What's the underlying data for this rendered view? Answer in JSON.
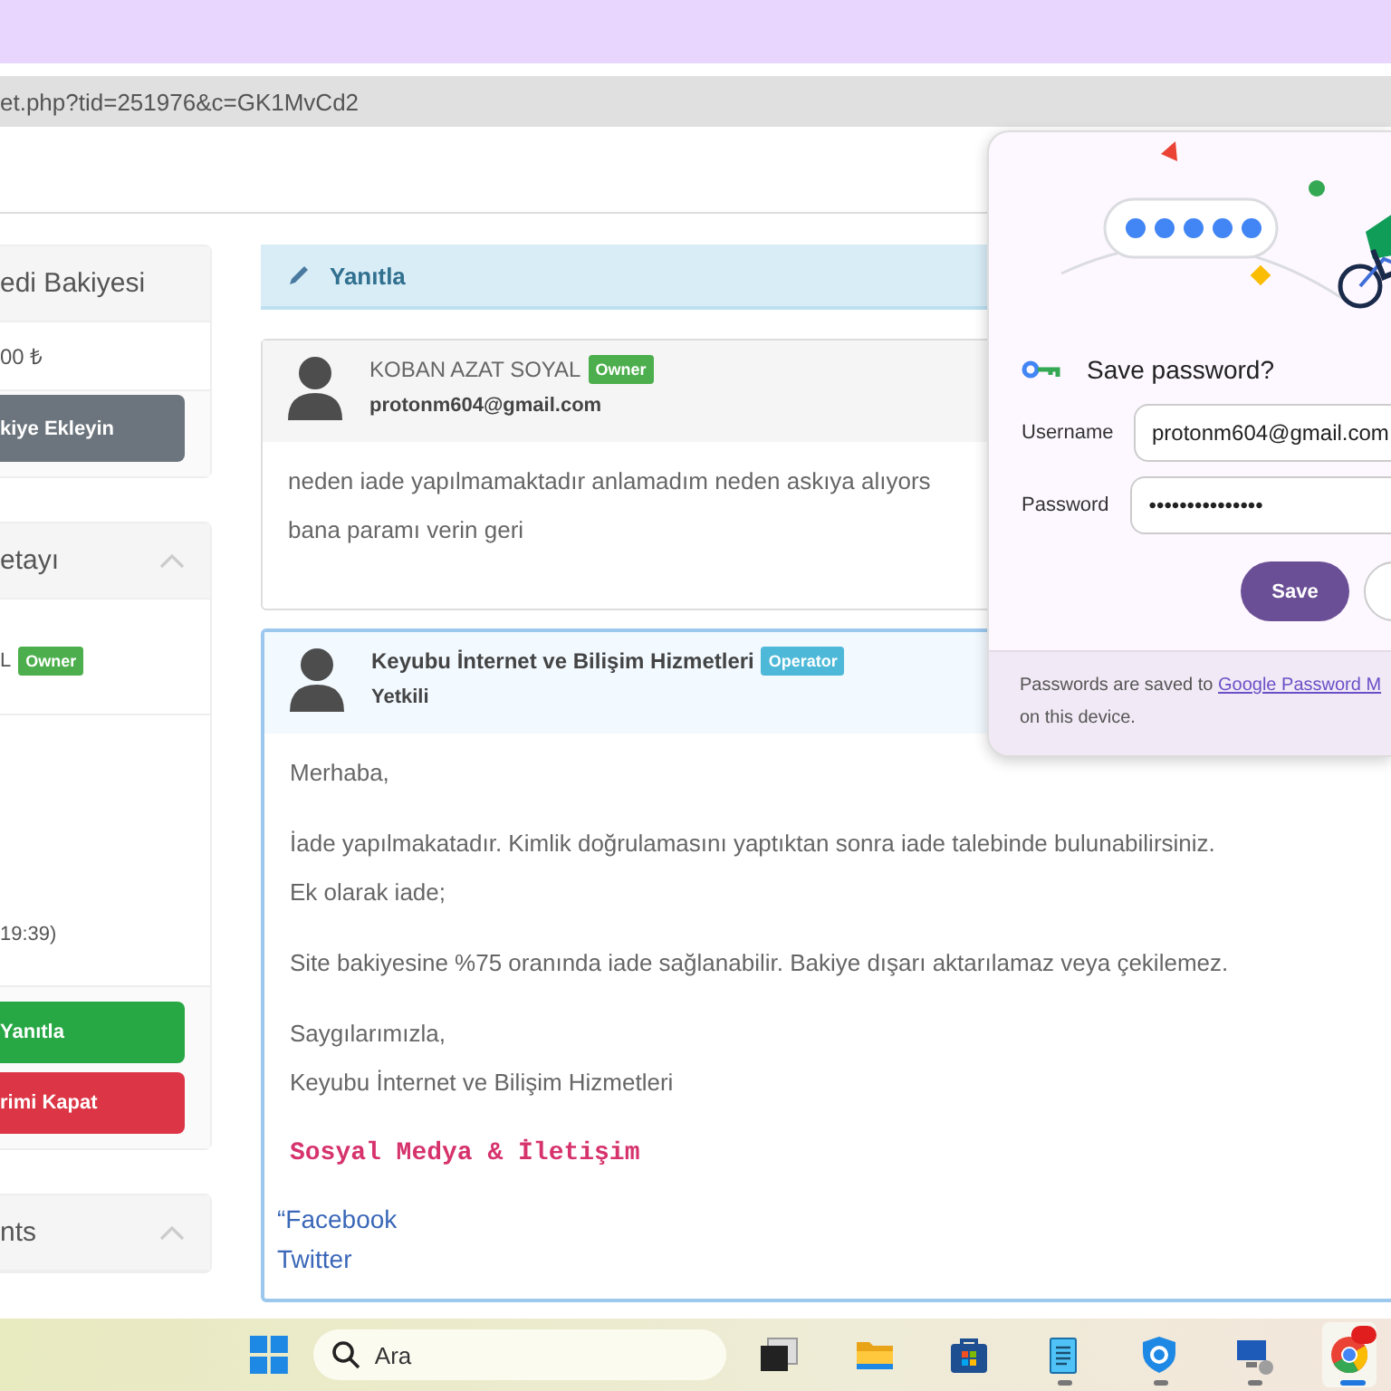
{
  "browser": {
    "url": "et.php?tid=251976&c=GK1MvCd2"
  },
  "sidebar": {
    "panels": [
      {
        "title": "edi Bakiyesi",
        "collapsible": false,
        "rows": [
          {
            "text": "00 ₺"
          }
        ],
        "buttons": [
          {
            "label": "kiye Ekleyin",
            "kind": "secondary"
          }
        ]
      },
      {
        "title": "etayı",
        "collapsible": true,
        "rows": [
          {
            "text": "L",
            "badge": {
              "text": "Owner",
              "kind": "owner"
            }
          },
          {
            "text": "19:39)"
          }
        ],
        "buttons": [
          {
            "label": "Yanıtla",
            "kind": "success"
          },
          {
            "label": "rimi Kapat",
            "kind": "danger"
          }
        ]
      },
      {
        "title": "nts",
        "collapsible": true
      }
    ]
  },
  "reply_bar": {
    "label": "Yanıtla"
  },
  "posts": [
    {
      "kind": "customer",
      "name": "KOBAN AZAT SOYAL",
      "badge": {
        "text": "Owner",
        "kind": "owner"
      },
      "subtitle": "protonm604@gmail.com",
      "blocks": [
        {
          "kind": "text",
          "lines": [
            "neden iade yapılmamaktadır anlamadım neden askıya alıyors",
            "bana paramı verin geri"
          ]
        }
      ]
    },
    {
      "kind": "staff",
      "name": "Keyubu İnternet ve Bilişim Hizmetleri",
      "badge": {
        "text": "Operator",
        "kind": "operator"
      },
      "subtitle": "Yetkili",
      "blocks": [
        {
          "kind": "text",
          "lines": [
            "Merhaba,"
          ]
        },
        {
          "kind": "text",
          "lines": [
            "İade yapılmakatadır. Kimlik doğrulamasını yaptıktan sonra iade talebinde bulunabilirsiniz.",
            "Ek olarak iade;"
          ]
        },
        {
          "kind": "text",
          "lines": [
            "Site bakiyesine %75 oranında iade sağlanabilir. Bakiye dışarı aktarılamaz veya çekilemez."
          ]
        },
        {
          "kind": "text",
          "lines": [
            "Saygılarımızla,",
            "Keyubu İnternet ve Bilişim Hizmetleri"
          ]
        },
        {
          "kind": "heading",
          "lines": [
            "Sosyal Medya & İletişim"
          ]
        },
        {
          "kind": "links",
          "lines": [
            "“Facebook",
            "Twitter"
          ]
        }
      ]
    }
  ],
  "password_popup": {
    "title": "Save password?",
    "fields": [
      {
        "label": "Username",
        "value": "protonm604@gmail.com"
      },
      {
        "label": "Password",
        "value": "•••••••••••••••"
      }
    ],
    "buttons": [
      {
        "label": "Save",
        "kind": "primary"
      },
      {
        "kind": "secondary"
      }
    ],
    "footer": {
      "before": "Passwords are saved to ",
      "link": "Google Password M",
      "after": "on this device."
    }
  },
  "taskbar": {
    "search": {
      "placeholder": "Ara"
    },
    "apps": [
      {
        "kind": "taskview",
        "open": false,
        "selected": false
      },
      {
        "kind": "folder",
        "open": false,
        "selected": false
      },
      {
        "kind": "store",
        "open": false,
        "selected": false
      },
      {
        "kind": "notepad",
        "open": true,
        "selected": false
      },
      {
        "kind": "shield",
        "open": true,
        "selected": false
      },
      {
        "kind": "computer",
        "open": true,
        "selected": false
      },
      {
        "kind": "chrome",
        "open": true,
        "selected": true
      }
    ]
  }
}
